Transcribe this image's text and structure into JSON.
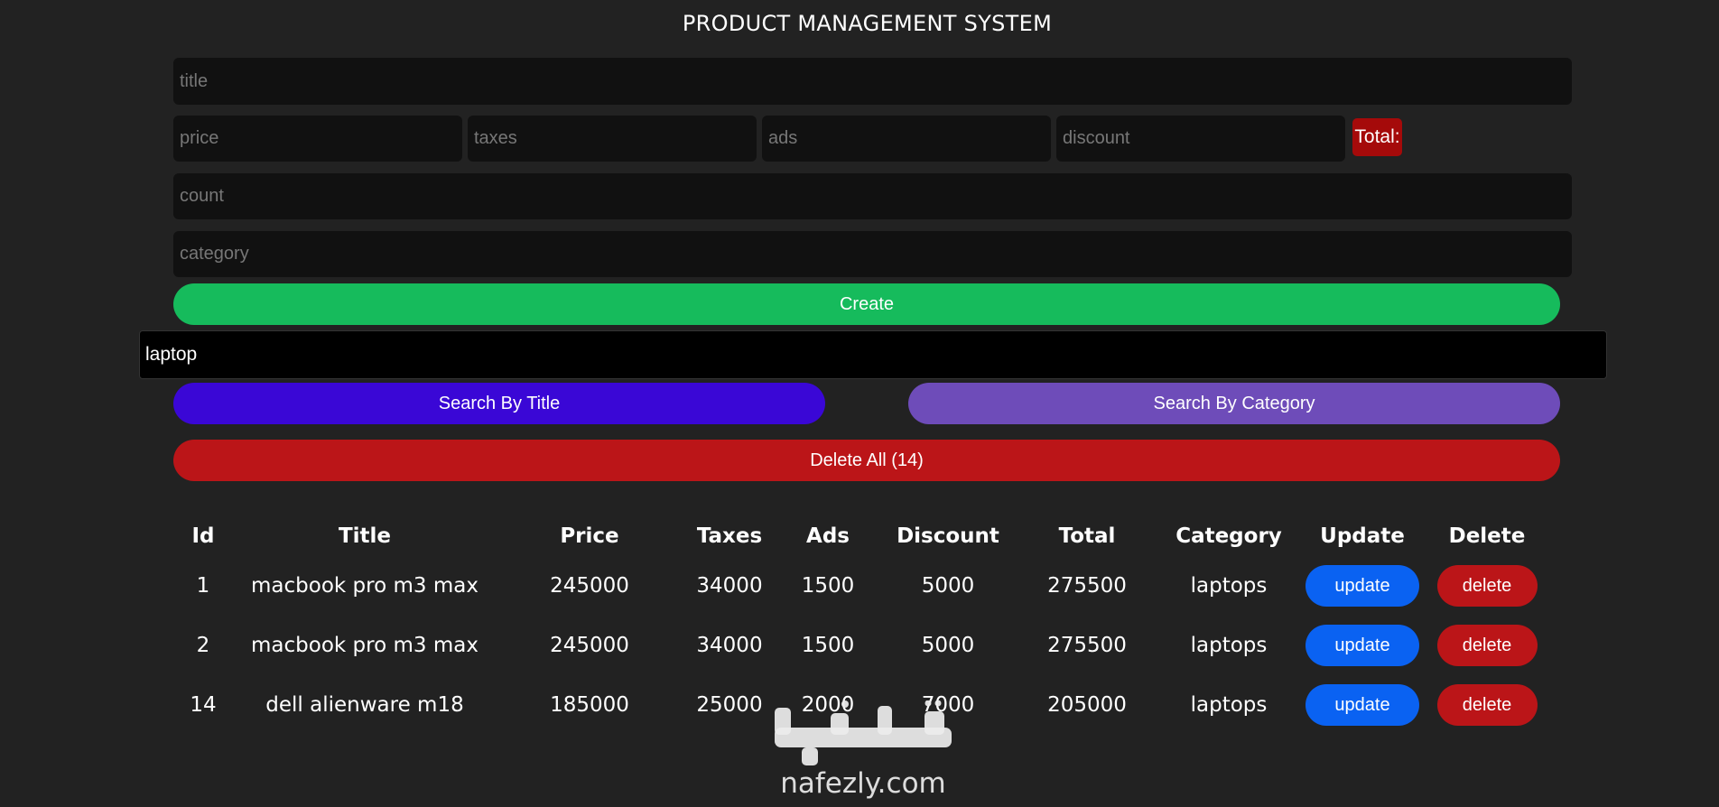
{
  "header": {
    "title": "PRODUCT MANAGEMENT SYSTEM"
  },
  "form": {
    "title_placeholder": "title",
    "price_placeholder": "price",
    "taxes_placeholder": "taxes",
    "ads_placeholder": "ads",
    "discount_placeholder": "discount",
    "total_label": "Total:",
    "count_placeholder": "count",
    "category_placeholder": "category",
    "create_label": "Create"
  },
  "search": {
    "value": "laptop",
    "by_title_label": "Search By Title",
    "by_category_label": "Search By Category"
  },
  "delete_all": {
    "label": "Delete All (14)"
  },
  "table": {
    "headers": [
      "Id",
      "Title",
      "Price",
      "Taxes",
      "Ads",
      "Discount",
      "Total",
      "Category",
      "Update",
      "Delete"
    ],
    "rows": [
      {
        "id": "1",
        "title": "macbook pro m3 max",
        "price": "245000",
        "taxes": "34000",
        "ads": "1500",
        "discount": "5000",
        "total": "275500",
        "category": "laptops",
        "update": "update",
        "delete": "delete"
      },
      {
        "id": "2",
        "title": "macbook pro m3 max",
        "price": "245000",
        "taxes": "34000",
        "ads": "1500",
        "discount": "5000",
        "total": "275500",
        "category": "laptops",
        "update": "update",
        "delete": "delete"
      },
      {
        "id": "14",
        "title": "dell alienware m18",
        "price": "185000",
        "taxes": "25000",
        "ads": "2000",
        "discount": "7000",
        "total": "205000",
        "category": "laptops",
        "update": "update",
        "delete": "delete"
      }
    ]
  },
  "watermark": {
    "text": "nafezly.com"
  },
  "colors": {
    "background": "#222222",
    "input_bg": "#111111",
    "create": "#16bb5c",
    "search_title": "#3a07d6",
    "search_category": "#6e4cb9",
    "delete_all": "#bb1518",
    "update": "#0a62f2",
    "delete": "#bb1518",
    "total_box": "#a50a0a"
  }
}
